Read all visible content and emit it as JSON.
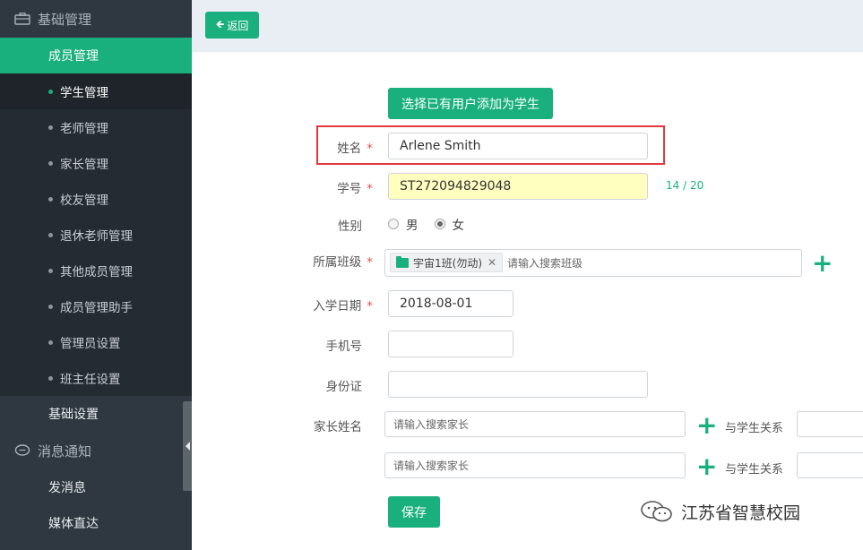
{
  "sidebar": {
    "section1_title": "基础管理",
    "members_label": "成员管理",
    "sub_items": [
      {
        "label": "学生管理"
      },
      {
        "label": "老师管理"
      },
      {
        "label": "家长管理"
      },
      {
        "label": "校友管理"
      },
      {
        "label": "退休老师管理"
      },
      {
        "label": "其他成员管理"
      },
      {
        "label": "成员管理助手"
      },
      {
        "label": "管理员设置"
      },
      {
        "label": "班主任设置"
      }
    ],
    "basic_settings": "基础设置",
    "section2_title": "消息通知",
    "send_message": "发消息",
    "media_direct": "媒体直达"
  },
  "topbar": {
    "back_label": "返回"
  },
  "form": {
    "select_existing_button": "选择已有用户添加为学生",
    "name_label": "姓名",
    "name_value": "Arlene Smith",
    "student_id_label": "学号",
    "student_id_value": "ST272094829048",
    "student_id_counter": "14 / 20",
    "gender_label": "性别",
    "gender_options": [
      "男",
      "女"
    ],
    "gender_selected": "女",
    "class_label": "所属班级",
    "class_tag": "宇宙1班(勿动)",
    "class_placeholder": "请输入搜索班级",
    "enroll_date_label": "入学日期",
    "enroll_date_value": "2018-08-01",
    "phone_label": "手机号",
    "phone_value": "",
    "id_card_label": "身份证",
    "id_card_value": "",
    "parent_label": "家长姓名",
    "parent_placeholder": "请输入搜索家长",
    "relation_label": "与学生关系",
    "required_mark": "*",
    "save_button": "保存"
  },
  "watermark": {
    "text": "江苏省智慧校园"
  },
  "colors": {
    "accent": "#1ab07d",
    "sidebar_bg": "#2f3740",
    "highlight": "#e0393e",
    "required": "#e0524a"
  }
}
